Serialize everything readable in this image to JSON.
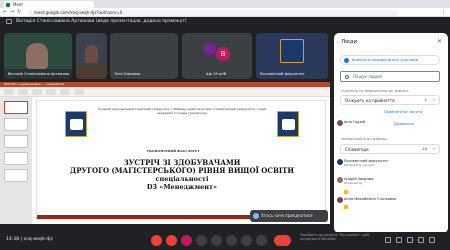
{
  "browser": {
    "tab_title": "Meet",
    "url": "meet.google.com/xnq-aeqh-djz?authuser=0"
  },
  "banner": {
    "text": "Вікторія Станіславівна Артюкова (веде презентацію, додано прямокут)"
  },
  "tiles": [
    {
      "name": "Вікторія Станіславівна Артюкова",
      "color": "#2d4a3e"
    },
    {
      "name": "",
      "color": "#3a4250"
    },
    {
      "name": "Тетя Оліковна",
      "color": "#3c4043",
      "avatar_letter": "",
      "avatar_color": "#5f6368"
    },
    {
      "name": "Ще 19 осіб",
      "color": "#3c4043",
      "avatar_letter": "B",
      "avatar_color": "#c2185b"
    },
    {
      "name": "Економічний факультет",
      "color": "#2b3a5a"
    }
  ],
  "slide": {
    "app_title": "ЗУСТРІЧ з здобувачами ... - PowerPoint",
    "university": "Луцький національний технічний університет «Міжнародний економіко-гуманітарний університет» імені академіка Степана Дем'янчука",
    "faculty": "ЕКОНОМІЧНИЙ ФАКУЛЬТЕТ",
    "line1": "ЗУСТРІЧ ЗІ ЗДОБУВАЧАМИ",
    "line2": "ДРУГОГО (МАГІСТЕРСЬКОГО) РІВНЯ ВИЩОЇ ОСВІТИ",
    "line3": "спеціальності",
    "line4": "D3 «Менеджмент»"
  },
  "toast": {
    "text": "Хтось хоче приєднатися"
  },
  "people_panel": {
    "title": "Люди",
    "mute_all": "Вимкнути мікрофони всіх учасників",
    "search_placeholder": "Пошук людей",
    "waiting_section": "ОЧІКУЮТЬ НА ПРИЄДНАННЯ ДО ДЗВІНКА",
    "waiting_group": "Очікують на прийняття",
    "waiting_count": "1",
    "admit_all": "Прийняти всі запити",
    "waiting_person": "Інна Гордій",
    "waiting_person_action": "Дозволити",
    "in_call_section": "ПРИЄДНАЛИСЯ ДО ДЗВІНКА",
    "in_call_group": "Співавтори",
    "in_call_count": "24",
    "person1": "Економічний факультет",
    "person1_sub": "Організатор зустрічі",
    "person2": "Андрій Закалюк",
    "person2_sub": "Організатор",
    "person3": "Анна Михайлівна Станковка",
    "person3_sub": ""
  },
  "bottom": {
    "time": "14:38",
    "code": "xnq-aeqh-djz",
    "activate": "Перейдіть до розділу \"Настройки\", щоб активувати Windows."
  },
  "colors": {
    "accent": "#1a73e8",
    "leave": "#ea4335",
    "ppt": "#b7472a"
  }
}
